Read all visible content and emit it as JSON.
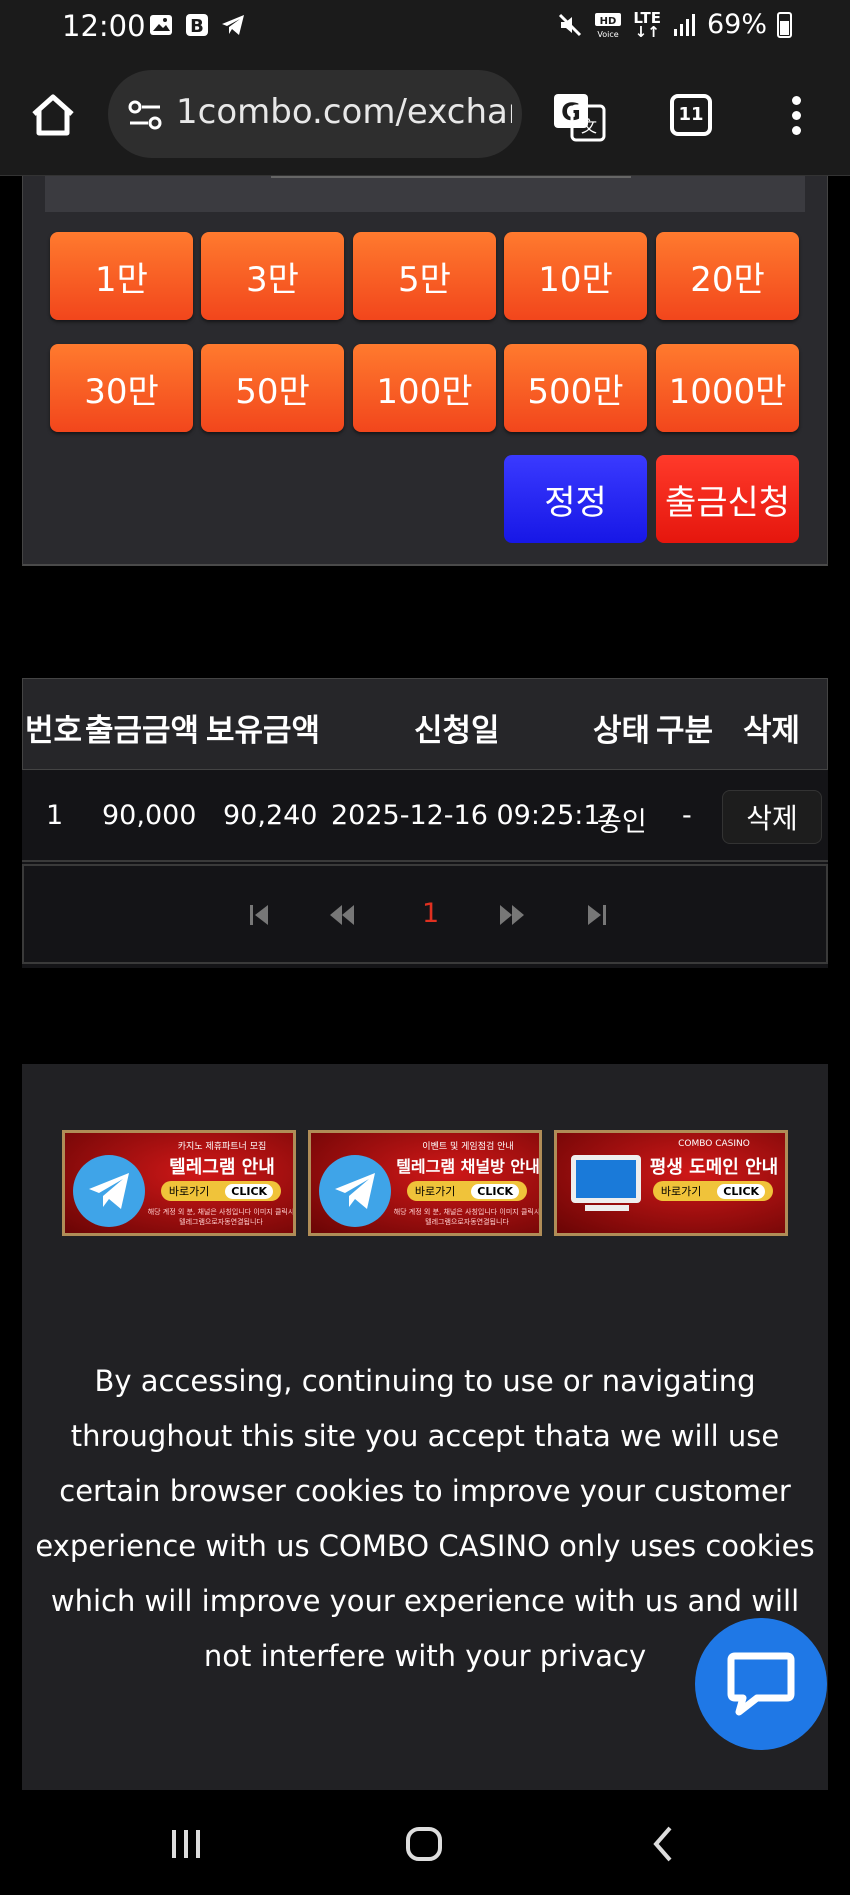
{
  "status_bar": {
    "time": "12:00",
    "lte_label": "LTE",
    "hd_label": "HD",
    "battery": "69%"
  },
  "browser": {
    "url": "1combo.com/exchan",
    "tab_count": "11"
  },
  "amount_buttons": [
    "1만",
    "3만",
    "5만",
    "10만",
    "20만",
    "30만",
    "50만",
    "100만",
    "500만",
    "1000만"
  ],
  "actions": {
    "correct": "정정",
    "request": "출금신청"
  },
  "table": {
    "headers": [
      "번호",
      "출금금액",
      "보유금액",
      "신청일",
      "상태",
      "구분",
      "삭제"
    ],
    "rows": [
      {
        "no": "1",
        "amount": "90,000",
        "balance": "90,240",
        "date": "2025-12-16 09:25:17",
        "status": "승인",
        "type": "-",
        "delete": "삭제"
      }
    ],
    "pagination": {
      "current": "1"
    }
  },
  "banners": [
    {
      "small": "카지노 제휴파트너 모집",
      "title": "텔레그램 안내",
      "go": "바로가기",
      "click": "CLICK",
      "foot": "해당 계정 외 분, 채널은 사칭입니다 이미지 클릭시 텔레그램으로자동연결됩니다"
    },
    {
      "small": "이벤트 및 게임점검 안내",
      "title": "텔레그램 채널방 안내",
      "go": "바로가기",
      "click": "CLICK",
      "foot": "해당 계정 외 분, 채널은 사칭입니다 이미지 클릭시 텔레그램으로자동연결됩니다"
    },
    {
      "small": "COMBO CASINO",
      "title": "평생 도메인 안내",
      "go": "바로가기",
      "click": "CLICK",
      "foot": ""
    }
  ],
  "cookie_notice": "By accessing, continuing to use or navigating throughout this site you accept thata we will use certain browser cookies to improve your customer experience with us COMBO CASINO only uses cookies which will improve your experience with us and will not interfere with your privacy",
  "colors": {
    "amount_button": "#f2561f",
    "correct_button": "#2222f0",
    "request_button": "#f0251a",
    "chat_button": "#1f78e6"
  }
}
